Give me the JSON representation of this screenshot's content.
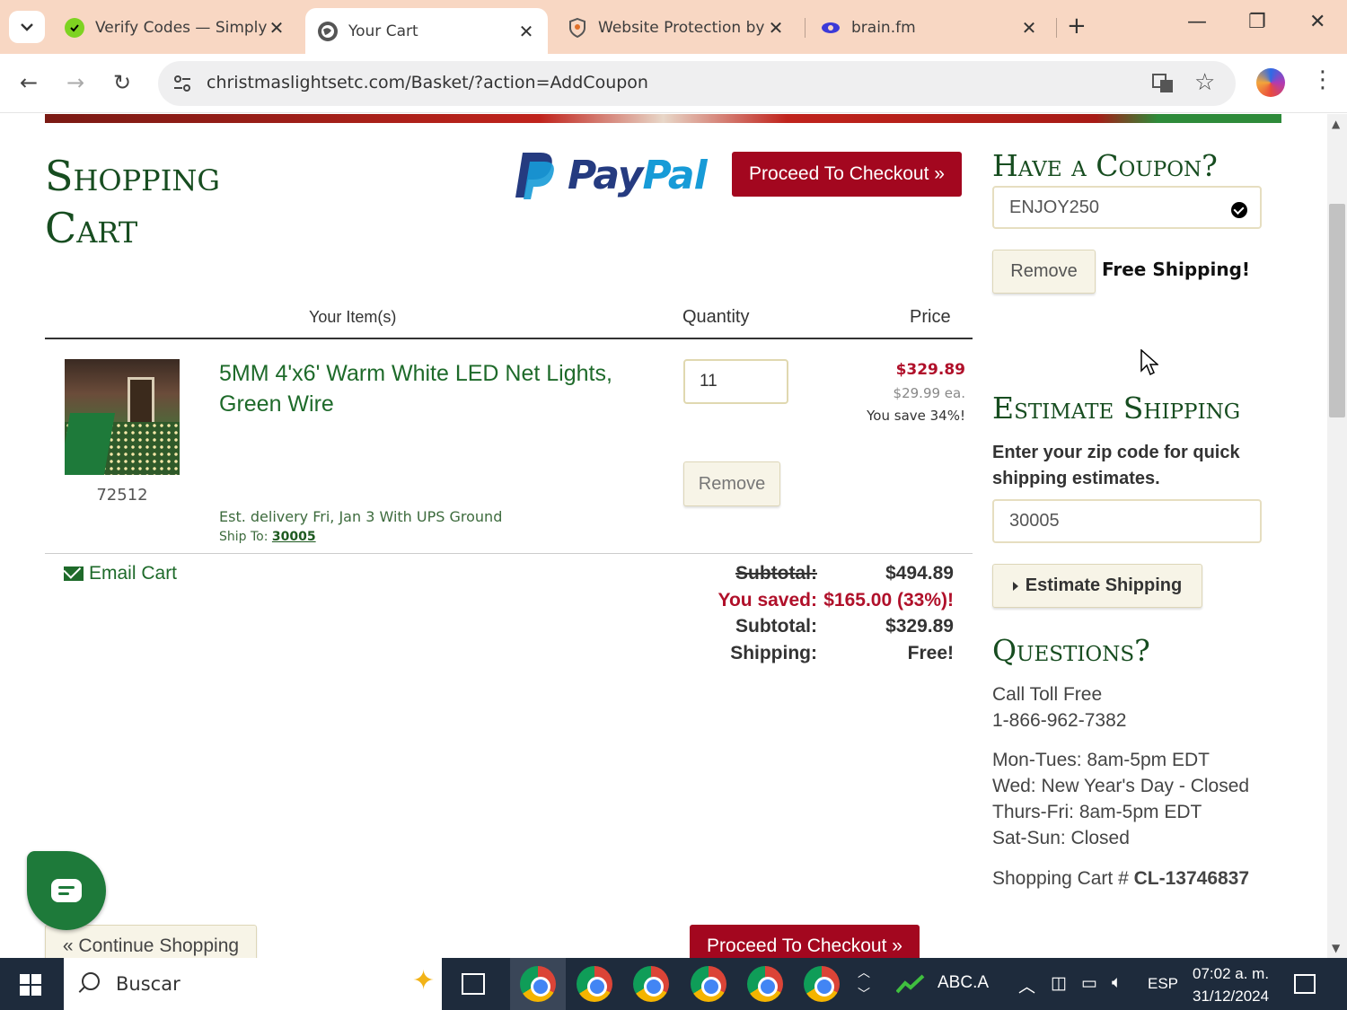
{
  "browser": {
    "tabs": [
      {
        "title": "Verify Codes — Simply",
        "active": false
      },
      {
        "title": "Your Cart",
        "active": true
      },
      {
        "title": "Website Protection by",
        "active": false
      },
      {
        "title": "brain.fm",
        "active": false
      }
    ],
    "url": "christmaslightsetc.com/Basket/?action=AddCoupon"
  },
  "cart": {
    "title": "Shopping Cart",
    "paypal_pay": "Pay",
    "paypal_pal": "Pal",
    "checkout_label": "Proceed To Checkout »",
    "columns": {
      "items": "Your Item(s)",
      "quantity": "Quantity",
      "price": "Price"
    },
    "item": {
      "name": "5MM 4'x6' Warm White LED Net Lights, Green Wire",
      "sku": "72512",
      "quantity": "11",
      "price_total": "$329.89",
      "price_each": "$29.99 ea.",
      "savings": "You save 34%!",
      "remove_label": "Remove",
      "delivery": "Est. delivery Fri, Jan 3 With UPS Ground",
      "ship_to_label": "Ship To:",
      "ship_to_zip": "30005"
    },
    "email_cart": "Email Cart",
    "totals": [
      {
        "label": "Subtotal:",
        "value": "$494.89",
        "style": "strike"
      },
      {
        "label": "You saved:",
        "value": "$165.00 (33%)!",
        "style": "saved"
      },
      {
        "label": "Subtotal:",
        "value": "$329.89",
        "style": "normal"
      },
      {
        "label": "Shipping:",
        "value": "Free!",
        "style": "normal"
      }
    ],
    "continue_label": "« Continue Shopping"
  },
  "sidebar": {
    "coupon_heading": "Have a Coupon?",
    "coupon_code": "ENJOY250",
    "coupon_remove": "Remove",
    "coupon_result": "Free Shipping!",
    "shipping_heading": "Estimate Shipping",
    "shipping_note": "Enter your zip code for quick shipping estimates.",
    "zip": "30005",
    "estimate_button": "Estimate Shipping",
    "questions_heading": "Questions?",
    "call_label": "Call Toll Free",
    "phone": "1-866-962-7382",
    "hours": [
      "Mon-Tues: 8am-5pm EDT",
      "Wed: New Year's Day - Closed",
      "Thurs-Fri: 8am-5pm EDT",
      "Sat-Sun: Closed"
    ],
    "cart_number_label": "Shopping Cart #",
    "cart_number": "CL-13746837"
  },
  "taskbar": {
    "search_placeholder": "Buscar",
    "stock": "ABC.A",
    "lang": "ESP",
    "time": "07:02 a. m.",
    "date": "31/12/2024"
  },
  "colors": {
    "accent_green": "#174d20",
    "checkout_red": "#a3071f",
    "price_red": "#b0102a"
  }
}
